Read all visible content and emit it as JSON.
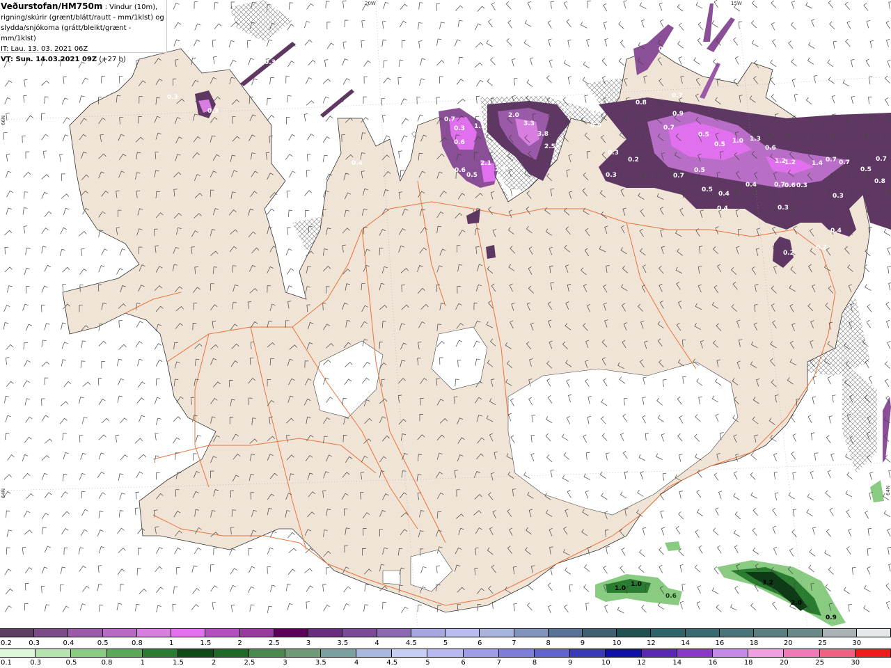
{
  "header": {
    "title": "Veðurstofan/HM750m",
    "title_suffix": " : Vindur (10m),",
    "line2": "rigning/skúrir (grænt/blátt/rautt - mm/1klst) og",
    "line3": "slydda/snjókoma (grátt/bleikt/grænt - mm/1klst)",
    "it": "IT: Lau. 13. 03. 2021 06Z",
    "vt": "VT: Sun. 14.03.2021 09Z",
    "vt_suffix": " (+27 h)"
  },
  "graticule": {
    "top_left": "20W",
    "top_right": "15W",
    "left_upper": "66N",
    "left_lower": "64N",
    "right_lower": "64N"
  },
  "precip_labels": {
    "snow": [
      "0.3",
      "0.3",
      "0.3",
      "0.4",
      "0.7",
      "0.3",
      "1.1",
      "0.6",
      "2.0",
      "3.3",
      "3.8",
      "2.5",
      "0.6",
      "0.8",
      "1.3",
      "2.1",
      "2.3",
      "0.6",
      "0.5",
      "0.7",
      "0.8",
      "0.9",
      "0.7",
      "0.5",
      "1.0",
      "1.3",
      "0.6",
      "0.5",
      "1.2",
      "1.2",
      "1.4",
      "0.7",
      "0.7",
      "0.5",
      "0.7",
      "0.8",
      "0.3",
      "0.2",
      "0.3",
      "0.4",
      "0.7",
      "0.5",
      "0.4",
      "0.4",
      "0.7",
      "0.6",
      "0.3",
      "0.5",
      "0.3",
      "0.3",
      "0.2",
      "0.2",
      "0.4",
      "0.7"
    ],
    "rain": [
      "1.0",
      "1.0",
      "0.6",
      "3.2",
      "2.0",
      "0.9"
    ]
  },
  "scale_snow": {
    "labels": [
      "0.2",
      "0.3",
      "0.4",
      "0.5",
      "0.8",
      "1",
      "1.5",
      "2",
      "2.5",
      "3",
      "3.5",
      "4",
      "4.5",
      "5",
      "6",
      "7",
      "8",
      "9",
      "10",
      "12",
      "14",
      "16",
      "18",
      "20",
      "25",
      "30"
    ],
    "colors": [
      "#5e3d62",
      "#7a4b86",
      "#9a5aa8",
      "#b76ac4",
      "#d77ee0",
      "#e36ef0",
      "#b44ec0",
      "#9a3aa0",
      "#5a0058",
      "#6a2c7c",
      "#7a4a94",
      "#8c6ab0",
      "#a8a6de",
      "#b8bcee",
      "#a8b4dc",
      "#8094bc",
      "#587296",
      "#3e6070",
      "#1e5050",
      "#2e6468",
      "#386a70",
      "#4a7478",
      "#5a7e80",
      "#6a8888",
      "#a8b2b4",
      "#e4e8e8"
    ]
  },
  "scale_rain": {
    "labels": [
      "0.1",
      "0.3",
      "0.5",
      "0.8",
      "1",
      "1.5",
      "2",
      "2.5",
      "3",
      "3.5",
      "4",
      "4.5",
      "5",
      "6",
      "7",
      "8",
      "9",
      "10",
      "12",
      "14",
      "16",
      "18",
      "20",
      "25",
      "30"
    ],
    "colors": [
      "#ddf6d8",
      "#b6e4ae",
      "#8acb82",
      "#5aa958",
      "#2a7c30",
      "#0e4a16",
      "#1e6828",
      "#4a8a4e",
      "#6e9a78",
      "#7aa0a0",
      "#a8b8e0",
      "#c6cef4",
      "#b8b8f0",
      "#9e9ee6",
      "#7e7ed8",
      "#6262cc",
      "#3a3ab8",
      "#1010a8",
      "#5a28b4",
      "#8a38c8",
      "#c68ae6",
      "#f0a0e0",
      "#f07ab8",
      "#f06080",
      "#ec1c1c"
    ]
  },
  "colors": {
    "land": "#f0e4d6",
    "coast": "#000000",
    "roads": "#e8753e",
    "glacier": "#ffffff",
    "hatch": "#888888",
    "snow_dark": "#6a3d72",
    "snow_light": "#e072ee",
    "rain": "#5aa058",
    "rain_dark": "#1e5028"
  },
  "icons": [
    "wind-barb-field",
    "cross-hatch-pattern"
  ]
}
